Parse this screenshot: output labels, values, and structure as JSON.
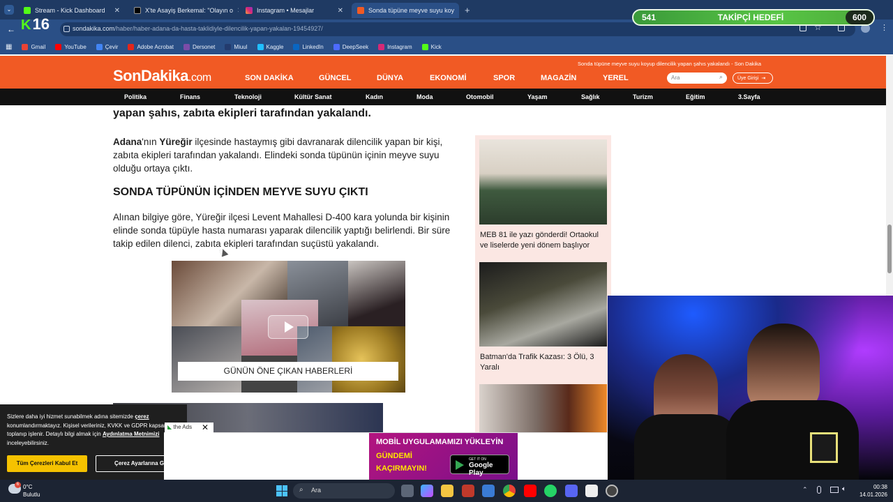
{
  "browser": {
    "tabs": [
      {
        "label": "Stream - Kick Dashboard",
        "active": false
      },
      {
        "label": "X'te Asayiş Berkemal: \"Olayın o",
        "active": false
      },
      {
        "label": "Instagram • Mesajlar",
        "active": false
      },
      {
        "label": "Sonda tüpüne meyve suyu koy",
        "active": true
      }
    ],
    "url_host": "sondakika.com",
    "url_path": "/haber/haber-adana-da-hasta-taklidiyle-dilencilik-yapan-yakalan-19454927/",
    "bookmarks": [
      "Gmail",
      "YouTube",
      "Çevir",
      "Adobe Acrobat",
      "Dersonet",
      "Miuul",
      "Kaggle",
      "LinkedIn",
      "DeepSeek",
      "Instagram",
      "Kick"
    ]
  },
  "overlay": {
    "brand_number": "16",
    "goal_current": "541",
    "goal_label": "TAKİPÇİ HEDEFİ",
    "goal_target": "600",
    "goal_progress": 0.9
  },
  "site": {
    "logo_main": "SonDakika",
    "logo_suffix": ".com",
    "ticker": "Sonda tüpüne meyve suyu koyup dilencilik yapan şahıs yakalandı - Son Dakika",
    "nav": [
      "SON DAKİKA",
      "GÜNCEL",
      "DÜNYA",
      "EKONOMİ",
      "SPOR",
      "MAGAZİN",
      "YEREL"
    ],
    "search_placeholder": "Ara",
    "login_label": "Üye Girişi",
    "categories": [
      "Politika",
      "Finans",
      "Teknoloji",
      "Kültür Sanat",
      "Kadın",
      "Moda",
      "Otomobil",
      "Yaşam",
      "Sağlık",
      "Turizm",
      "Eğitim",
      "3.Sayfa"
    ]
  },
  "article": {
    "lead_tail": "yapan şahıs, zabıta ekipleri tarafından yakalandı.",
    "p1_b1": "Adana",
    "p1_t1": "'nın ",
    "p1_b2": "Yüreğir",
    "p1_t2": " ilçesinde hastaymış gibi davranarak dilencilik yapan bir kişi, zabıta ekipleri tarafından yakalandı. Elindeki sonda tüpünün içinin meyve suyu olduğu ortaya çıktı.",
    "subheading": "SONDA TÜPÜNÜN İÇİNDEN MEYVE SUYU ÇIKTI",
    "p2": "Alınan bilgiye göre, Yüreğir ilçesi Levent Mahallesi D-400 kara yolunda bir kişinin elinde sonda tüpüyle hasta numarası yaparak dilencilik yaptığı belirlendi. Bir süre takip edilen dilenci, zabıta ekipleri tarafından suçüstü yakalandı.",
    "video_caption": "GÜNÜN ÖNE ÇIKAN HABERLERİ"
  },
  "sidebar": {
    "items": [
      {
        "caption": "MEB 81 ile yazı gönderdi! Ortaokul ve liselerde yeni dönem başlıyor"
      },
      {
        "caption": "Batman'da Trafik Kazası: 3 Ölü, 3 Yaralı"
      }
    ]
  },
  "cookie": {
    "text_a": "Sizlere daha iyi hizmet sunabilmek adına sitemizde ",
    "link1": "çerez",
    "text_b": " konumlandırmaktayız. Kişisel verileriniz, KVKK ve GDPR kapsamında toplanıp işlenir. Detaylı bilgi almak için ",
    "link2": "Aydınlatma Metnimizi",
    "text_c": " inceleyebilirsiniz.",
    "accept": "Tüm Çerezleri Kabul Et",
    "settings": "Çerez Ayarlarına Git"
  },
  "ad": {
    "tag": "the Ads",
    "line1": "MOBİL UYGULAMAMIZI YÜKLEYİN",
    "line2": "GÜNDEMİ",
    "line3": "KAÇIRMAYIN!",
    "store_small": "GET IT ON",
    "store": "Google Play"
  },
  "taskbar": {
    "temp": "0°C",
    "weather": "Bulutlu",
    "search": "Ara",
    "time": "00:38",
    "date": "14.01.2026"
  },
  "colors": {
    "site_orange": "#f15a24",
    "browser_blue": "#2a4f86",
    "goal_green": "#58c545",
    "sidebar_pink": "#fbe7e3"
  }
}
